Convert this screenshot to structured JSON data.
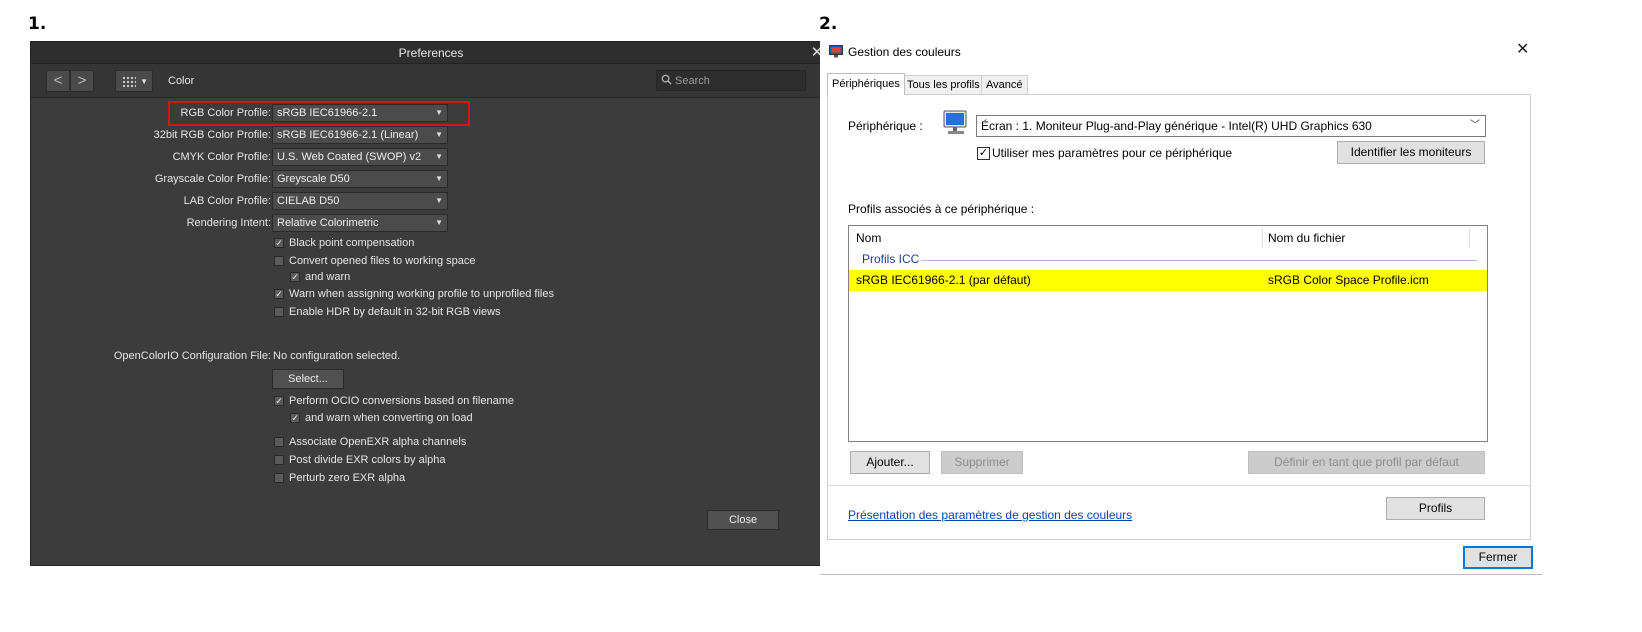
{
  "labels": {
    "panel1": "1.",
    "panel2": "2."
  },
  "affinity": {
    "title": "Preferences",
    "close_glyph": "✕",
    "toolbar": {
      "back": "<",
      "forward": ">",
      "section": "Color",
      "search_placeholder": "Search"
    },
    "fields": [
      {
        "label": "RGB Color Profile:",
        "value": "sRGB IEC61966-2.1"
      },
      {
        "label": "32bit RGB Color Profile:",
        "value": "sRGB IEC61966-2.1 (Linear)"
      },
      {
        "label": "CMYK Color Profile:",
        "value": "U.S. Web Coated (SWOP) v2"
      },
      {
        "label": "Grayscale Color Profile:",
        "value": "Greyscale D50"
      },
      {
        "label": "LAB Color Profile:",
        "value": "CIELAB D50"
      },
      {
        "label": "Rendering Intent:",
        "value": "Relative Colorimetric"
      }
    ],
    "checks": [
      {
        "label": "Black point compensation",
        "checked": true
      },
      {
        "label": "Convert opened files to working space",
        "checked": false
      },
      {
        "label": "and warn",
        "checked": true
      },
      {
        "label": "Warn when assigning working profile to unprofiled files",
        "checked": true
      },
      {
        "label": "Enable HDR by default in 32-bit RGB views",
        "checked": false
      }
    ],
    "ocio": {
      "label": "OpenColorIO Configuration File:",
      "value": "No configuration selected.",
      "select_button": "Select...",
      "checks": [
        {
          "label": "Perform OCIO conversions based on filename",
          "checked": true
        },
        {
          "label": "and warn when converting on load",
          "checked": true
        },
        {
          "label": "Associate OpenEXR alpha channels",
          "checked": false
        },
        {
          "label": "Post divide EXR colors by alpha",
          "checked": false
        },
        {
          "label": "Perturb zero EXR alpha",
          "checked": false
        }
      ]
    },
    "close_button": "Close",
    "highlight_color": "#e01010"
  },
  "windows": {
    "title": "Gestion des couleurs",
    "close_glyph": "✕",
    "tabs": [
      "Périphériques",
      "Tous les profils",
      "Avancé"
    ],
    "device_label": "Périphérique :",
    "device_value": "Écran : 1. Moniteur Plug-and-Play générique - Intel(R) UHD Graphics 630",
    "use_settings_label": "Utiliser mes paramètres pour ce périphérique",
    "use_settings_checked": true,
    "identify_button": "Identifier les moniteurs",
    "profiles_heading": "Profils associés à ce périphérique :",
    "columns": [
      "Nom",
      "Nom du fichier"
    ],
    "group": "Profils ICC",
    "rows": [
      {
        "name": "sRGB IEC61966-2.1 (par défaut)",
        "file": "sRGB Color Space Profile.icm"
      }
    ],
    "add_button": "Ajouter...",
    "remove_button": "Supprimer",
    "set_default_button": "Définir en tant que profil par défaut",
    "link": "Présentation des paramètres de gestion des couleurs",
    "profiles_button": "Profils",
    "close_button": "Fermer",
    "highlight_color": "#ffff00"
  }
}
